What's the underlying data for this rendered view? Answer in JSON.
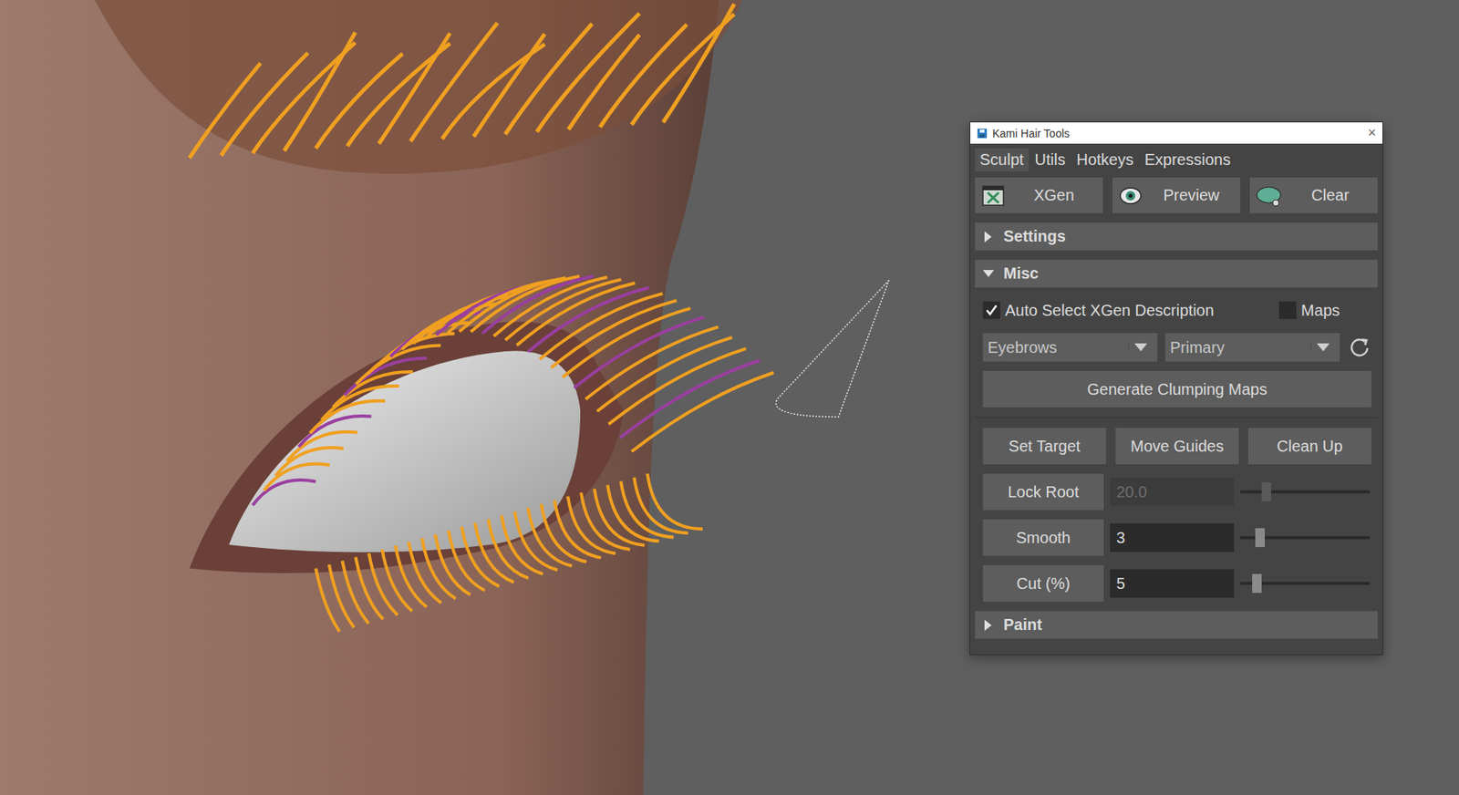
{
  "window": {
    "title": "Kami Hair Tools",
    "close": "×"
  },
  "tabs": [
    {
      "label": "Sculpt",
      "selected": true
    },
    {
      "label": "Utils",
      "selected": false
    },
    {
      "label": "Hotkeys",
      "selected": false
    },
    {
      "label": "Expressions",
      "selected": false
    }
  ],
  "toolbar": [
    {
      "label": "XGen"
    },
    {
      "label": "Preview"
    },
    {
      "label": "Clear"
    }
  ],
  "sections": [
    {
      "title": "Settings",
      "expanded": false
    },
    {
      "title": "Misc",
      "expanded": true
    },
    {
      "title": "Paint",
      "expanded": false
    }
  ],
  "misc": {
    "checkboxes": [
      {
        "label": "Auto Select XGen Description",
        "checked": true
      },
      {
        "label": "Maps",
        "checked": false
      }
    ],
    "dropdowns": [
      {
        "value": "Eyebrows"
      },
      {
        "value": "Primary"
      }
    ],
    "generate_button": "Generate Clumping Maps",
    "actions": [
      "Set Target",
      "Move Guides",
      "Clean Up"
    ],
    "sliders": [
      {
        "label": "Lock Root",
        "value": "20.0",
        "level": 0.2,
        "disabled": true
      },
      {
        "label": "Smooth",
        "value": "3",
        "level": 0.15,
        "disabled": false
      },
      {
        "label": "Cut (%)",
        "value": "5",
        "level": 0.13,
        "disabled": false
      }
    ]
  }
}
